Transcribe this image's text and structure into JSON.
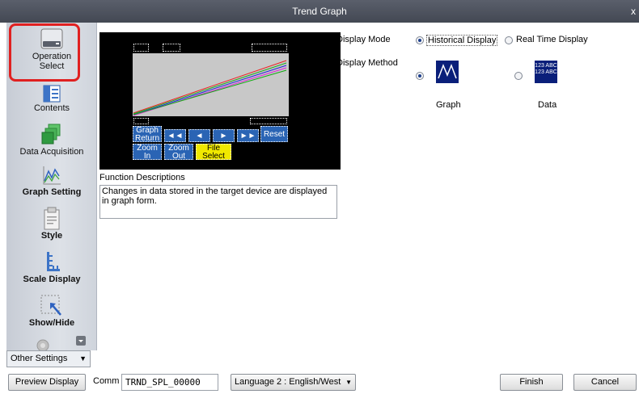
{
  "window": {
    "title": "Trend Graph",
    "close_label": "x"
  },
  "sidebar": {
    "items": [
      {
        "label_line1": "Operation",
        "label_line2": "Select"
      },
      {
        "label": "Contents"
      },
      {
        "label": "Data Acquisition"
      },
      {
        "label": "Graph Setting"
      },
      {
        "label": "Style"
      },
      {
        "label": "Scale Display"
      },
      {
        "label": "Show/Hide"
      }
    ],
    "other_settings": "Other Settings"
  },
  "preview": {
    "buttons": {
      "graph_return_1": "Graph",
      "graph_return_2": "Return",
      "rewind_fast": "◄◄",
      "rewind": "◄",
      "forward": "►",
      "forward_fast": "►►",
      "reset": "Reset",
      "zoom_in_1": "Zoom",
      "zoom_in_2": "In",
      "zoom_out_1": "Zoom",
      "zoom_out_2": "Out",
      "file_select_1": "File",
      "file_select_2": "Select"
    },
    "accent_color": "#2a64b4",
    "file_button_color": "#f0e800"
  },
  "function_descriptions": {
    "label": "Function Descriptions",
    "text": "Changes in data stored in the target device are displayed in graph form."
  },
  "display_mode": {
    "label": "Display Mode",
    "options": [
      "Historical Display",
      "Real Time Display"
    ],
    "selected": "Historical Display"
  },
  "display_method": {
    "label": "Display Method",
    "options": [
      "Graph",
      "Data"
    ],
    "selected": "Graph",
    "data_icon_text_1": "123 ABC",
    "data_icon_text_2": "123 ABC"
  },
  "footer": {
    "preview_display": "Preview Display",
    "comm_label": "Comm",
    "comm_value": "TRND_SPL_00000",
    "language": "Language 2 : English/West",
    "finish": "Finish",
    "cancel": "Cancel"
  }
}
